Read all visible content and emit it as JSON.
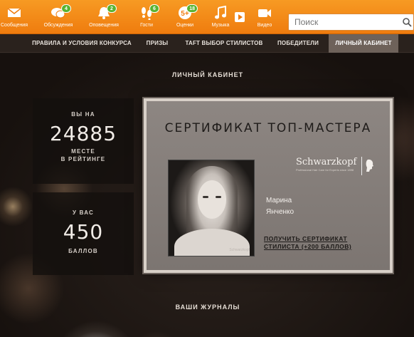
{
  "topnav": {
    "items": [
      {
        "label": "Сообщения",
        "icon": "envelope-icon",
        "badge": ""
      },
      {
        "label": "Обсуждения",
        "icon": "discussion-icon",
        "badge": "4"
      },
      {
        "label": "Оповещения",
        "icon": "bell-icon",
        "badge": "2"
      },
      {
        "label": "Гости",
        "icon": "footprints-icon",
        "badge": "6"
      },
      {
        "label": "Оценки",
        "icon": "ratings-icon",
        "badge": "18"
      },
      {
        "label": "Музыка",
        "icon": "music-note-icon",
        "badge": ""
      },
      {
        "label": "Видео",
        "icon": "video-camera-icon",
        "badge": ""
      }
    ],
    "search_placeholder": "Поиск",
    "accent": "#ef7c0e",
    "badge_color": "#59b331"
  },
  "menu": {
    "items": [
      {
        "label": "ПРАВИЛА И УСЛОВИЯ КОНКУРСА",
        "active": false
      },
      {
        "label": "ПРИЗЫ",
        "active": false
      },
      {
        "label": "TAFT ВЫБОР СТИЛИСТОВ",
        "active": false
      },
      {
        "label": "ПОБЕДИТЕЛИ",
        "active": false
      },
      {
        "label": "ЛИЧНЫЙ КАБИНЕТ",
        "active": true
      }
    ]
  },
  "main": {
    "title": "ЛИЧНЫЙ КАБИНЕТ",
    "rank": {
      "line1": "ВЫ НА",
      "value": "24885",
      "line2": "МЕСТЕ",
      "line3": "В РЕЙТИНГЕ"
    },
    "points": {
      "line1": "У ВАС",
      "value": "450",
      "line2": "БАЛЛОВ"
    },
    "certificate": {
      "title": "СЕРТИФИКАТ ТОП-МАСТЕРА",
      "brand": "Schwarzkopf",
      "brand_tagline": "Professional Hair Care for Experts since 1898",
      "photo_caption": "Schwarzkopf",
      "first_name": "Марина",
      "last_name": "Янченко",
      "link_line1": "ПОЛУЧИТЬ СЕРТИФИКАТ",
      "link_line2": "СТИЛИСТА (+200 БАЛЛОВ)"
    },
    "journals_title": "ВАШИ ЖУРНАЛЫ"
  }
}
